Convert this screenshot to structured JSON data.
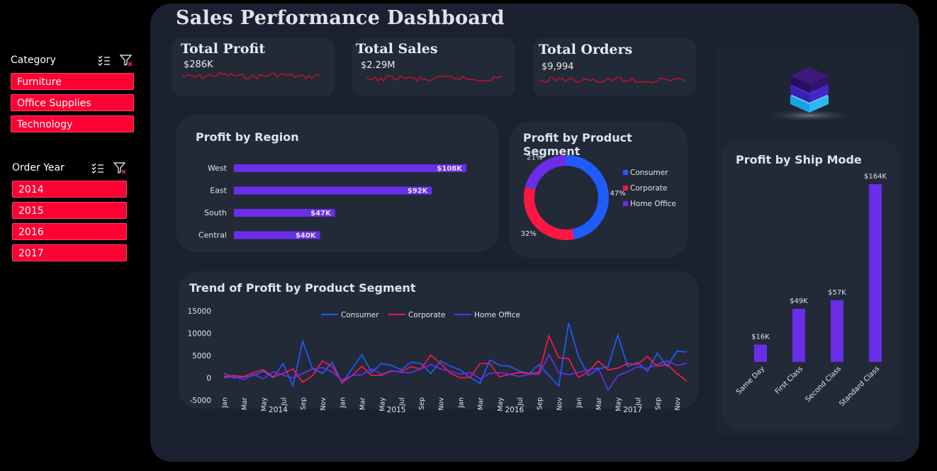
{
  "title": "Sales Performance Dashboard",
  "slicers": {
    "category": {
      "title": "Category",
      "items": [
        "Furniture",
        "Office Supplies",
        "Technology"
      ]
    },
    "order_year": {
      "title": "Order Year",
      "items": [
        "2014",
        "2015",
        "2016",
        "2017"
      ]
    }
  },
  "kpis": [
    {
      "title": "Total Profit",
      "value": "$286K"
    },
    {
      "title": "Total Sales",
      "value": "$2.29M"
    },
    {
      "title": "Total Orders",
      "value": "$9,994"
    }
  ],
  "colors": {
    "accent": "#6a2ee8",
    "consumer": "#1e5cff",
    "corporate": "#ff1744",
    "home_office": "#6a2ee8",
    "slicer": "#ff0033",
    "spark": "#c0122d"
  },
  "chart_data": [
    {
      "type": "bar",
      "orientation": "horizontal",
      "title": "Profit by Region",
      "categories": [
        "West",
        "East",
        "South",
        "Central"
      ],
      "values": [
        108,
        92,
        47,
        40
      ],
      "labels": [
        "$108K",
        "$92K",
        "$47K",
        "$40K"
      ],
      "unit": "K",
      "xlim": [
        0,
        108
      ]
    },
    {
      "type": "pie",
      "donut": true,
      "title": "Profit by Product Segment",
      "categories": [
        "Consumer",
        "Corporate",
        "Home Office"
      ],
      "values": [
        47,
        32,
        21
      ],
      "labels": [
        "47%",
        "32%",
        "21%"
      ],
      "legend": "right"
    },
    {
      "type": "bar",
      "title": "Profit by Ship Mode",
      "categories": [
        "Same Day",
        "First Class",
        "Second Class",
        "Standard Class"
      ],
      "values": [
        16,
        49,
        57,
        164
      ],
      "labels": [
        "$16K",
        "$49K",
        "$57K",
        "$164K"
      ],
      "unit": "K",
      "ylim": [
        0,
        164
      ]
    },
    {
      "type": "line",
      "title": "Trend of Profit by Product Segment",
      "y_ticks": [
        "15000",
        "10000",
        "5000",
        "0",
        "-5000"
      ],
      "ylim": [
        -5000,
        15000
      ],
      "x_month_labels": [
        "Jan",
        "Mar",
        "May",
        "Jul",
        "Sep",
        "Nov"
      ],
      "x_years": [
        "2014",
        "2015",
        "2016",
        "2017"
      ],
      "legend": "top",
      "series": [
        {
          "name": "Consumer",
          "values": [
            1000,
            0,
            200,
            500,
            1500,
            0,
            3200,
            -1800,
            8200,
            2000,
            1000,
            3500,
            -1200,
            2000,
            5200,
            1200,
            3200,
            2800,
            1800,
            3500,
            3200,
            1000,
            3800,
            2600,
            1800,
            100,
            -1200,
            4000,
            2800,
            2600,
            1500,
            1000,
            3000,
            500,
            -1800,
            12300,
            4800,
            500,
            2000,
            2500,
            9600,
            2500,
            3500,
            1500,
            5500,
            2500,
            6000,
            5800
          ]
        },
        {
          "name": "Corporate",
          "values": [
            300,
            500,
            300,
            1200,
            1800,
            200,
            1000,
            2000,
            -1000,
            500,
            3800,
            2500,
            -1000,
            500,
            2600,
            500,
            600,
            1500,
            1400,
            2500,
            2000,
            5100,
            3200,
            1000,
            0,
            100,
            3200,
            3200,
            200,
            800,
            1200,
            1000,
            1200,
            9400,
            4500,
            4300,
            100,
            1300,
            3800,
            1800,
            2200,
            3200,
            3000,
            4800,
            2600,
            3000,
            1000,
            -800
          ]
        },
        {
          "name": "Home Office",
          "values": [
            0,
            300,
            -400,
            800,
            -200,
            1400,
            600,
            0,
            1000,
            2000,
            2300,
            1300,
            -500,
            500,
            700,
            2000,
            800,
            1600,
            1200,
            1200,
            2000,
            3000,
            2000,
            1500,
            800,
            1200,
            -200,
            1000,
            1200,
            800,
            300,
            800,
            800,
            5200,
            1200,
            700,
            1200,
            1800,
            2200,
            -2800,
            500,
            1400,
            2500,
            2100,
            3000,
            3800,
            2800,
            3300
          ]
        }
      ]
    }
  ]
}
